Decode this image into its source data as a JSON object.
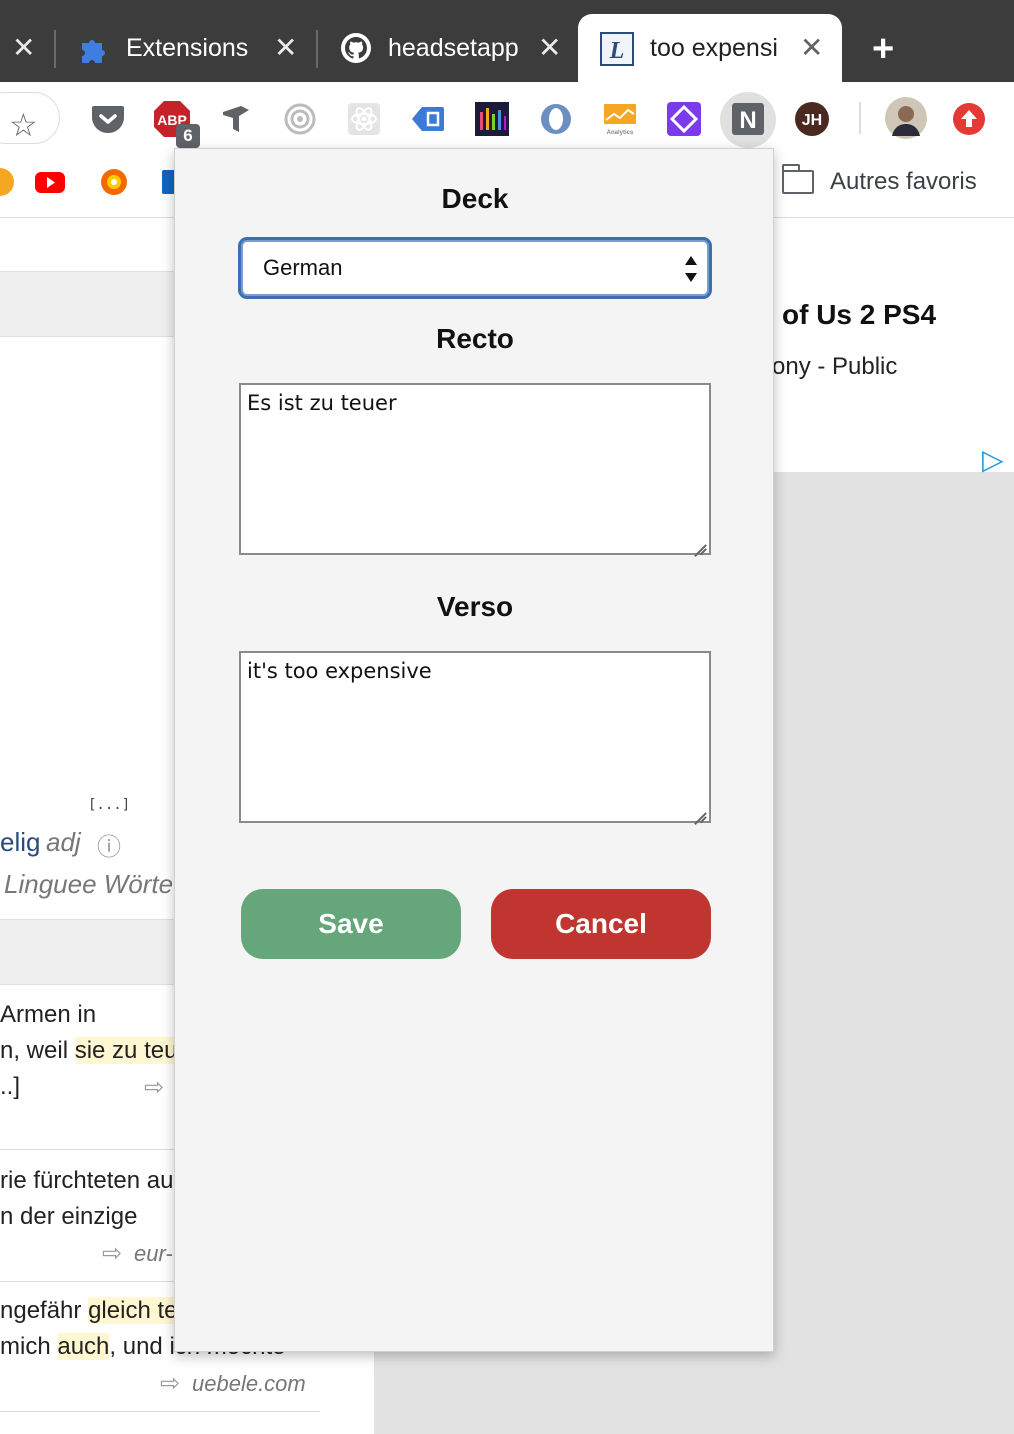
{
  "colors": {
    "tabstrip": "#3c3c3c",
    "save_button": "#65a67b",
    "cancel_button": "#c13530",
    "select_focus": "#3d6fb0",
    "popup_bg": "#f4f4f4"
  },
  "tabs": [
    {
      "title": "",
      "icon": "close-icon",
      "active": false
    },
    {
      "title": "Extensions",
      "icon": "puzzle-icon",
      "active": false
    },
    {
      "title": "headsetapp",
      "icon": "github-icon",
      "active": false
    },
    {
      "title": "too expensi",
      "icon": "linguee-icon",
      "active": true
    }
  ],
  "toolbar": {
    "extensions": [
      {
        "name": "pocket-icon"
      },
      {
        "name": "adblock-plus-icon",
        "label": "ABP",
        "badge": "6"
      },
      {
        "name": "tag-assistant-icon"
      },
      {
        "name": "target-icon"
      },
      {
        "name": "react-devtools-icon"
      },
      {
        "name": "tag-icon"
      },
      {
        "name": "bars-chart-icon"
      },
      {
        "name": "o-ring-icon"
      },
      {
        "name": "analytics-icon",
        "label": "Analytics"
      },
      {
        "name": "diamond-icon"
      },
      {
        "name": "notion-icon",
        "label": "N"
      },
      {
        "name": "jh-icon",
        "label": "JH"
      },
      {
        "name": "profile-avatar"
      },
      {
        "name": "upload-icon"
      }
    ]
  },
  "bookmarks": {
    "other_label": "Autres favoris"
  },
  "page": {
    "ad_title": "of Us 2 PS4",
    "ad_subtitle": "ony - Public",
    "ellipsis": "[...]",
    "word": "elig",
    "word_pos": "adj",
    "linguee_words": "Linguee Wörte",
    "line1": "Armen in",
    "line2_prefix": "n, weil ",
    "line2_highlight": "sie zu teu",
    "line3": "..]",
    "line4": "rie fürchteten au",
    "line5": "n der einzige",
    "source1": "eur-",
    "line6_prefix": "ngefähr ",
    "line6_highlight": "gleich teu",
    "line7_prefix": "mich ",
    "line7_highlight": "auch",
    "line7_suffix": ", und ich möchte",
    "source2": "uebele.com"
  },
  "popup": {
    "deck_label": "Deck",
    "deck_value": "German",
    "recto_label": "Recto",
    "recto_value": "Es ist zu teuer",
    "verso_label": "Verso",
    "verso_value": "it's too expensive",
    "save_label": "Save",
    "cancel_label": "Cancel"
  }
}
